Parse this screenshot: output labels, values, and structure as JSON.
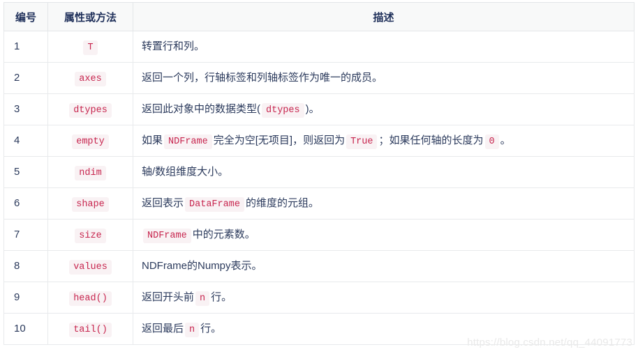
{
  "table": {
    "headers": [
      "编号",
      "属性或方法",
      "描述"
    ],
    "rows": [
      {
        "num": "1",
        "attr": "T",
        "desc_parts": [
          {
            "type": "text",
            "value": "转置行和列。"
          }
        ]
      },
      {
        "num": "2",
        "attr": "axes",
        "desc_parts": [
          {
            "type": "text",
            "value": "返回一个列，行轴标签和列轴标签作为唯一的成员。"
          }
        ]
      },
      {
        "num": "3",
        "attr": "dtypes",
        "desc_parts": [
          {
            "type": "text",
            "value": "返回此对象中的数据类型("
          },
          {
            "type": "code",
            "value": "dtypes"
          },
          {
            "type": "text",
            "value": ")。"
          }
        ]
      },
      {
        "num": "4",
        "attr": "empty",
        "desc_parts": [
          {
            "type": "text",
            "value": "如果"
          },
          {
            "type": "code",
            "value": "NDFrame"
          },
          {
            "type": "text",
            "value": "完全为空[无项目]，则返回为"
          },
          {
            "type": "code",
            "value": "True"
          },
          {
            "type": "text",
            "value": "；如果任何轴的长度为"
          },
          {
            "type": "code",
            "value": "0"
          },
          {
            "type": "text",
            "value": "。"
          }
        ]
      },
      {
        "num": "5",
        "attr": "ndim",
        "desc_parts": [
          {
            "type": "text",
            "value": "轴/数组维度大小。"
          }
        ]
      },
      {
        "num": "6",
        "attr": "shape",
        "desc_parts": [
          {
            "type": "text",
            "value": "返回表示"
          },
          {
            "type": "code",
            "value": "DataFrame"
          },
          {
            "type": "text",
            "value": "的维度的元组。"
          }
        ]
      },
      {
        "num": "7",
        "attr": "size",
        "desc_parts": [
          {
            "type": "text",
            "value": " "
          },
          {
            "type": "code",
            "value": "NDFrame"
          },
          {
            "type": "text",
            "value": "中的元素数。"
          }
        ]
      },
      {
        "num": "8",
        "attr": "values",
        "desc_parts": [
          {
            "type": "text",
            "value": "NDFrame的Numpy表示。"
          }
        ]
      },
      {
        "num": "9",
        "attr": "head()",
        "desc_parts": [
          {
            "type": "text",
            "value": "返回开头前"
          },
          {
            "type": "code",
            "value": "n"
          },
          {
            "type": "text",
            "value": "行。"
          }
        ]
      },
      {
        "num": "10",
        "attr": "tail()",
        "desc_parts": [
          {
            "type": "text",
            "value": "返回最后"
          },
          {
            "type": "code",
            "value": "n"
          },
          {
            "type": "text",
            "value": "行。"
          }
        ]
      }
    ]
  },
  "watermark": "https://blog.csdn.net/qq_44091773",
  "colors": {
    "code_text": "#c7254e",
    "code_bg": "#f9f2f4",
    "header_bg": "#f8f9f9",
    "border": "#e8eaec",
    "text": "#2b3a5c",
    "header_text": "#20315b",
    "watermark": "#e9e9e9"
  }
}
